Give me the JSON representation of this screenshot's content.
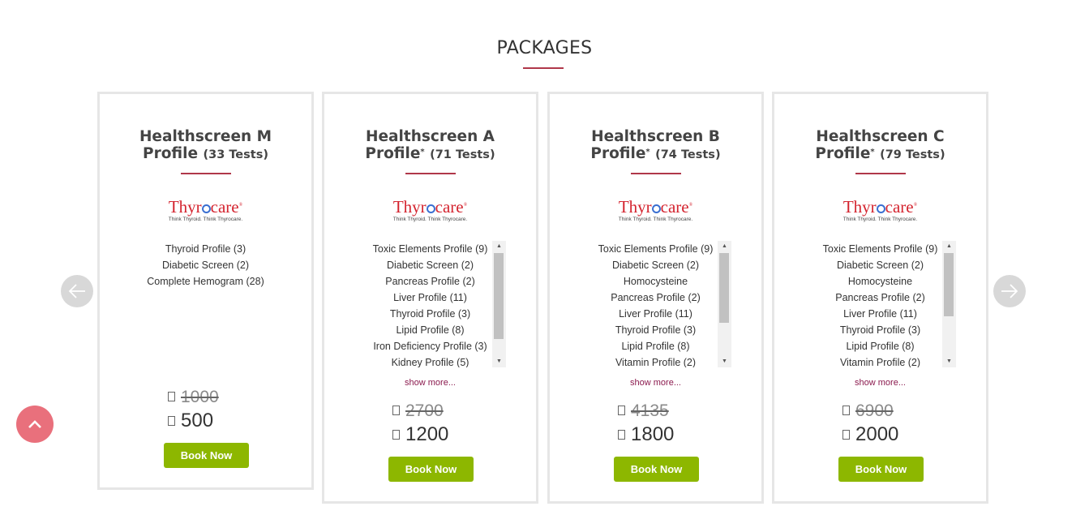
{
  "section": {
    "title": "PACKAGES",
    "accent_color": "#b0384a"
  },
  "logo": {
    "brand_left": "Thyr",
    "brand_right": "care",
    "registered": "®",
    "tagline": "Think Thyroid. Think Thyrocare."
  },
  "currency_icon": "rupee-glyph-placeholder",
  "show_more_label": "show more...",
  "book_label": "Book Now",
  "cards": [
    {
      "title_line1": "Healthscreen M",
      "title_line2": "Profile",
      "asterisk": "",
      "tests": "(33 Tests)",
      "items": [
        "Thyroid Profile (3)",
        "Diabetic Screen (2)",
        "Complete Hemogram (28)"
      ],
      "old_price": "1000",
      "new_price": "500"
    },
    {
      "title_line1": "Healthscreen A",
      "title_line2": "Profile",
      "asterisk": "*",
      "tests": "(71 Tests)",
      "items": [
        "Toxic Elements Profile (9)",
        "Diabetic Screen (2)",
        "Pancreas Profile (2)",
        "Liver Profile (11)",
        "Thyroid Profile (3)",
        "Lipid Profile (8)",
        "Iron Deficiency Profile (3)",
        "Kidney Profile (5)"
      ],
      "old_price": "2700",
      "new_price": "1200"
    },
    {
      "title_line1": "Healthscreen B",
      "title_line2": "Profile",
      "asterisk": "*",
      "tests": "(74 Tests)",
      "items": [
        "Toxic Elements Profile (9)",
        "Diabetic Screen (2)",
        "Homocysteine",
        "Pancreas Profile (2)",
        "Liver Profile (11)",
        "Thyroid Profile (3)",
        "Lipid Profile (8)",
        "Vitamin Profile (2)"
      ],
      "old_price": "4135",
      "new_price": "1800"
    },
    {
      "title_line1": "Healthscreen C",
      "title_line2": "Profile",
      "asterisk": "*",
      "tests": "(79 Tests)",
      "items": [
        "Toxic Elements Profile (9)",
        "Diabetic Screen (2)",
        "Homocysteine",
        "Pancreas Profile (2)",
        "Liver Profile (11)",
        "Thyroid Profile (3)",
        "Lipid Profile (8)",
        "Vitamin Profile (2)"
      ],
      "old_price": "6900",
      "new_price": "2000"
    }
  ],
  "nav": {
    "prev_icon": "arrow-left-icon",
    "next_icon": "arrow-right-icon",
    "back_to_top_icon": "chevron-up-icon"
  },
  "colors": {
    "book_button": "#8db700",
    "back_to_top": "#e9707c",
    "show_more": "#8b1a4e"
  }
}
